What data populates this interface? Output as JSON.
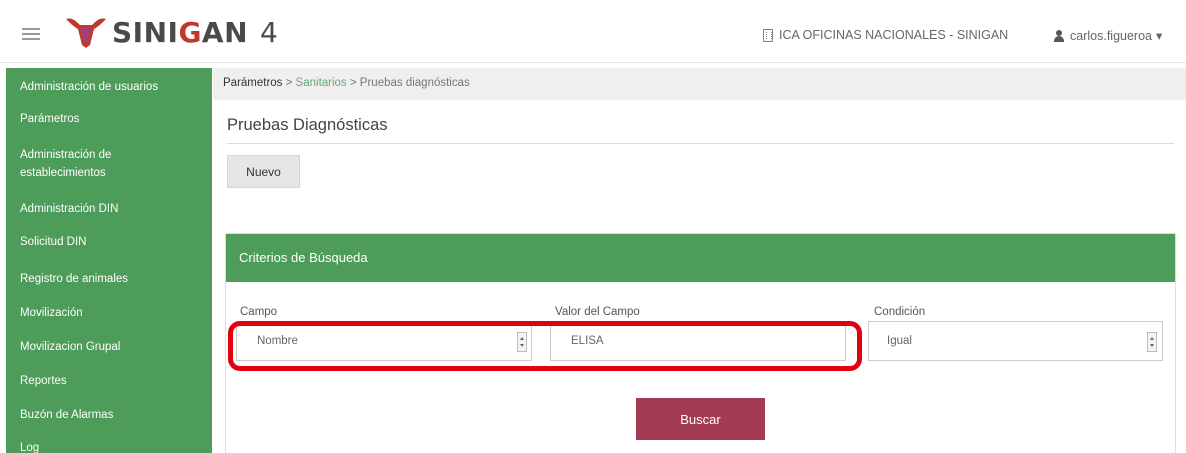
{
  "header": {
    "brand": {
      "pre": "SINI",
      "accent": "G",
      "post": "AN"
    },
    "version": "4",
    "office": "ICA OFICINAS NACIONALES - SINIGAN",
    "user": "carlos.figueroa"
  },
  "sidebar": {
    "items": [
      {
        "label": "Administración de usuarios"
      },
      {
        "label": "Parámetros"
      },
      {
        "label": "Administración de"
      },
      {
        "label": "establecimientos"
      },
      {
        "label": "Administración DIN"
      },
      {
        "label": "Solicitud DIN"
      },
      {
        "label": "Registro de animales"
      },
      {
        "label": "Movilización"
      },
      {
        "label": "Movilizacion Grupal"
      },
      {
        "label": "Reportes"
      },
      {
        "label": "Buzón de Alarmas"
      },
      {
        "label": "Log"
      }
    ]
  },
  "breadcrumb": {
    "item1": "Parámetros",
    "sep": " > ",
    "item2": "Sanitarios",
    "item3": "Pruebas diagnósticas"
  },
  "page": {
    "title": "Pruebas Diagnósticas",
    "new_button": "Nuevo"
  },
  "search": {
    "panel_title": "Criterios de Búsqueda",
    "campo_label": "Campo",
    "campo_value": "Nombre",
    "valor_label": "Valor del Campo",
    "valor_value": "ELISA",
    "condicion_label": "Condición",
    "condicion_value": "Igual",
    "search_button": "Buscar"
  },
  "colors": {
    "sidebar": "#4d9c5a",
    "panel_header": "#4d9c5a",
    "search_button": "#a33b52",
    "highlight": "#e3000f"
  }
}
